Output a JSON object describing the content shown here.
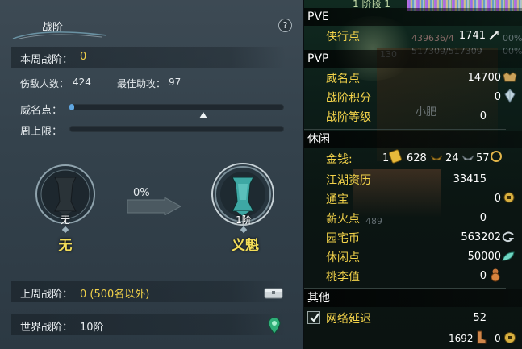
{
  "zhanjie": {
    "title": "战阶",
    "help_label": "?",
    "weekly_label": "本周战阶：",
    "weekly_value": "0",
    "injured_label": "伤敌人数：",
    "injured_value": "424",
    "assist_label": "最佳助攻：",
    "assist_value": "97",
    "reputation_label": "威名点：",
    "weekly_cap_label": "周上限：",
    "current_badge": {
      "sub": "无",
      "name": "无"
    },
    "progress_label": "0%",
    "next_badge": {
      "sub": "1阶",
      "name": "义魁"
    },
    "last_week_label": "上周战阶：",
    "last_week_value": "0 (500名以外)",
    "world_label": "世界战阶：",
    "world_value": "10阶"
  },
  "stats": {
    "top_stripe_text": "1 阶段 1",
    "ghost_hp": "439636/4",
    "ghost_mp": "517309/517309",
    "ghost_lv": "130",
    "ghost_percent1": "00%",
    "ghost_percent2": "00%",
    "ghost_xiaofei": "小肥",
    "ghost_489": "489",
    "pve": {
      "header": "PVE",
      "items": [
        {
          "label": "侠行点",
          "value": "1741",
          "icon": "quill-icon"
        }
      ]
    },
    "pvp": {
      "header": "PVP",
      "items": [
        {
          "label": "威名点",
          "value": "14700",
          "icon": "reputation-icon"
        },
        {
          "label": "战阶积分",
          "value": "0",
          "icon": "crystal-icon"
        },
        {
          "label": "战阶等级",
          "value": "0"
        }
      ]
    },
    "leisure": {
      "header": "休闲",
      "money_label": "金钱:",
      "money_gold": "1",
      "money_silver": "628",
      "money_copper": "24",
      "money_last": "57",
      "items": [
        {
          "label": "江湖资历",
          "value": "33415"
        },
        {
          "label": "通宝",
          "value": "0",
          "icon": "coin-icon"
        },
        {
          "label": "薪火点",
          "value": "0"
        },
        {
          "label": "园宅币",
          "value": "563202",
          "icon": "garden-coin-icon"
        },
        {
          "label": "休闲点",
          "value": "50000",
          "icon": "leaf-icon"
        },
        {
          "label": "桃李值",
          "value": "0",
          "icon": "gourd-icon"
        }
      ]
    },
    "other": {
      "header": "其他",
      "network_label": "网络延迟",
      "network_value": "52",
      "bottom_left_value": "1692",
      "bottom_right_value": "0"
    },
    "colors": {
      "label": "#f2d24a",
      "value": "#ffffff",
      "badge": "#f3dd58"
    }
  }
}
